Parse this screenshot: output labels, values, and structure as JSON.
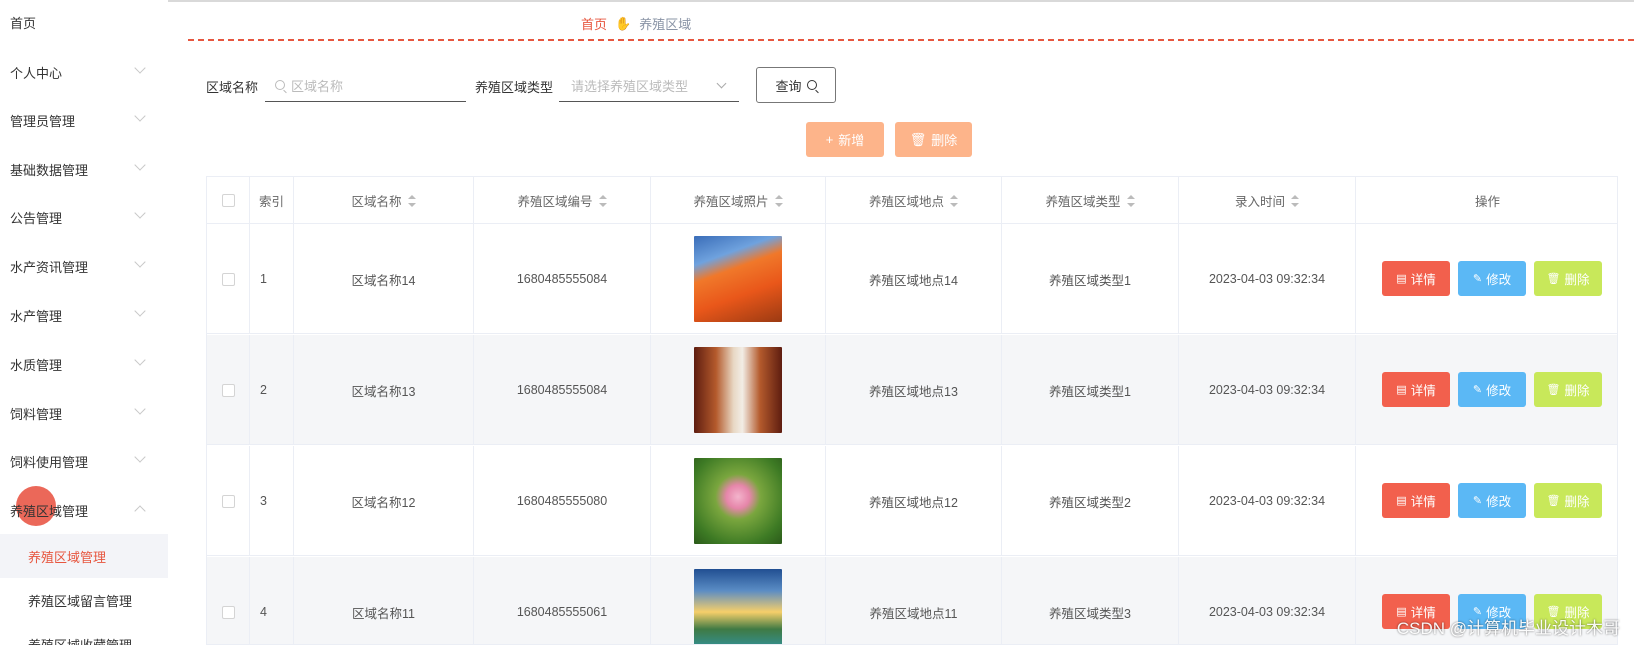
{
  "sidebar": {
    "items": [
      {
        "label": "首页",
        "has_arrow": false
      },
      {
        "label": "个人中心",
        "has_arrow": true
      },
      {
        "label": "管理员管理",
        "has_arrow": true
      },
      {
        "label": "基础数据管理",
        "has_arrow": true
      },
      {
        "label": "公告管理",
        "has_arrow": true
      },
      {
        "label": "水产资讯管理",
        "has_arrow": true
      },
      {
        "label": "水产管理",
        "has_arrow": true
      },
      {
        "label": "水质管理",
        "has_arrow": true
      },
      {
        "label": "饲料管理",
        "has_arrow": true
      },
      {
        "label": "饲料使用管理",
        "has_arrow": true
      },
      {
        "label": "养殖区域管理",
        "has_arrow": true,
        "expanded": true
      }
    ],
    "sub_items": [
      {
        "label": "养殖区域管理",
        "active": true
      },
      {
        "label": "养殖区域留言管理",
        "active": false
      },
      {
        "label": "养殖区域收藏管理",
        "active": false
      }
    ]
  },
  "breadcrumb": {
    "home": "首页",
    "hand_icon": "✋",
    "current": "养殖区域"
  },
  "search": {
    "name_label": "区域名称",
    "name_placeholder": "区域名称",
    "type_label": "养殖区域类型",
    "type_placeholder": "请选择养殖区域类型",
    "query_label": "查询"
  },
  "actions": {
    "add_label": "新增",
    "add_icon": "+",
    "delete_label": "删除",
    "delete_icon": "🗑"
  },
  "table": {
    "headers": {
      "index": "索引",
      "name": "区域名称",
      "code": "养殖区域编号",
      "photo": "养殖区域照片",
      "location": "养殖区域地点",
      "type": "养殖区域类型",
      "time": "录入时间",
      "ops": "操作"
    },
    "rows": [
      {
        "index": "1",
        "name": "区域名称14",
        "code": "1680485555084",
        "location": "养殖区域地点14",
        "type": "养殖区域类型1",
        "time": "2023-04-03 09:32:34"
      },
      {
        "index": "2",
        "name": "区域名称13",
        "code": "1680485555084",
        "location": "养殖区域地点13",
        "type": "养殖区域类型1",
        "time": "2023-04-03 09:32:34"
      },
      {
        "index": "3",
        "name": "区域名称12",
        "code": "1680485555080",
        "location": "养殖区域地点12",
        "type": "养殖区域类型2",
        "time": "2023-04-03 09:32:34"
      },
      {
        "index": "4",
        "name": "区域名称11",
        "code": "1680485555061",
        "location": "养殖区域地点11",
        "type": "养殖区域类型3",
        "time": "2023-04-03 09:32:34"
      }
    ],
    "op_labels": {
      "detail": "详情",
      "edit": "修改",
      "delete": "删除"
    }
  },
  "colors": {
    "accent": "#e7563f",
    "add_button": "#fdb48a",
    "detail_button": "#f2604d",
    "edit_button": "#5bb8f5",
    "delete_button": "#c8e85a"
  },
  "watermark": "CSDN @计算机毕业设计木哥"
}
